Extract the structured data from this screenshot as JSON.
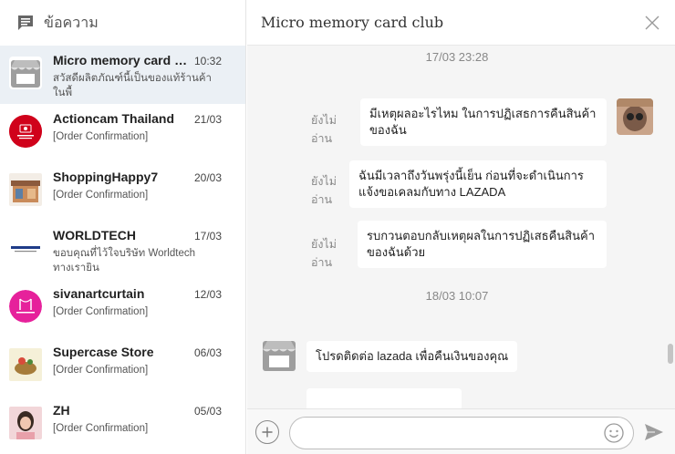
{
  "left_header": {
    "title": "ข้อความ"
  },
  "conversations": [
    {
      "name": "Micro memory card club",
      "time": "10:32",
      "preview": "สวัสดีผลิตภัณฑ์นี้เป็นของแท้ร้านค้าในพื้"
    },
    {
      "name": "Actioncam Thailand",
      "time": "21/03",
      "preview": "[Order Confirmation]"
    },
    {
      "name": "ShoppingHappy7",
      "time": "20/03",
      "preview": "[Order Confirmation]"
    },
    {
      "name": "WORLDTECH",
      "time": "17/03",
      "preview": "ขอบคุณที่ไว้ใจบริษัท Worldtech ทางเรายิน"
    },
    {
      "name": "sivanartcurtain",
      "time": "12/03",
      "preview": "[Order Confirmation]"
    },
    {
      "name": "Supercase Store",
      "time": "06/03",
      "preview": "[Order Confirmation]"
    },
    {
      "name": "ZH",
      "time": "05/03",
      "preview": "[Order Confirmation]"
    }
  ],
  "chat": {
    "title": "Micro memory card club",
    "date1": "17/03 23:28",
    "date2": "18/03 10:07",
    "unread_label_line1": "ยังไม่",
    "unread_label_line2": "อ่าน",
    "messages": [
      {
        "line1": "มีเหตุผลอะไรไหม ในการปฏิเสธการคืนสินค้า",
        "line2": "ของฉัน"
      },
      {
        "line1": "ฉันมีเวลาถึงวันพรุ่งนี้เย็น ก่อนที่จะดำเนินการ",
        "line2": "แจ้งขอเคลมกับทาง LAZADA"
      },
      {
        "line1": "รบกวนตอบกลับเหตุผลในการปฏิเสธคืนสินค้า",
        "line2": "ของฉันด้วย"
      }
    ],
    "reply": "โปรดติดต่อ lazada เพื่อคืนเงินของคุณ"
  },
  "composer": {
    "placeholder": ""
  },
  "colors": {
    "active_bg": "#ebf0f5",
    "panel_bg": "#f5f5f5",
    "bubble_bg": "#ffffff"
  }
}
